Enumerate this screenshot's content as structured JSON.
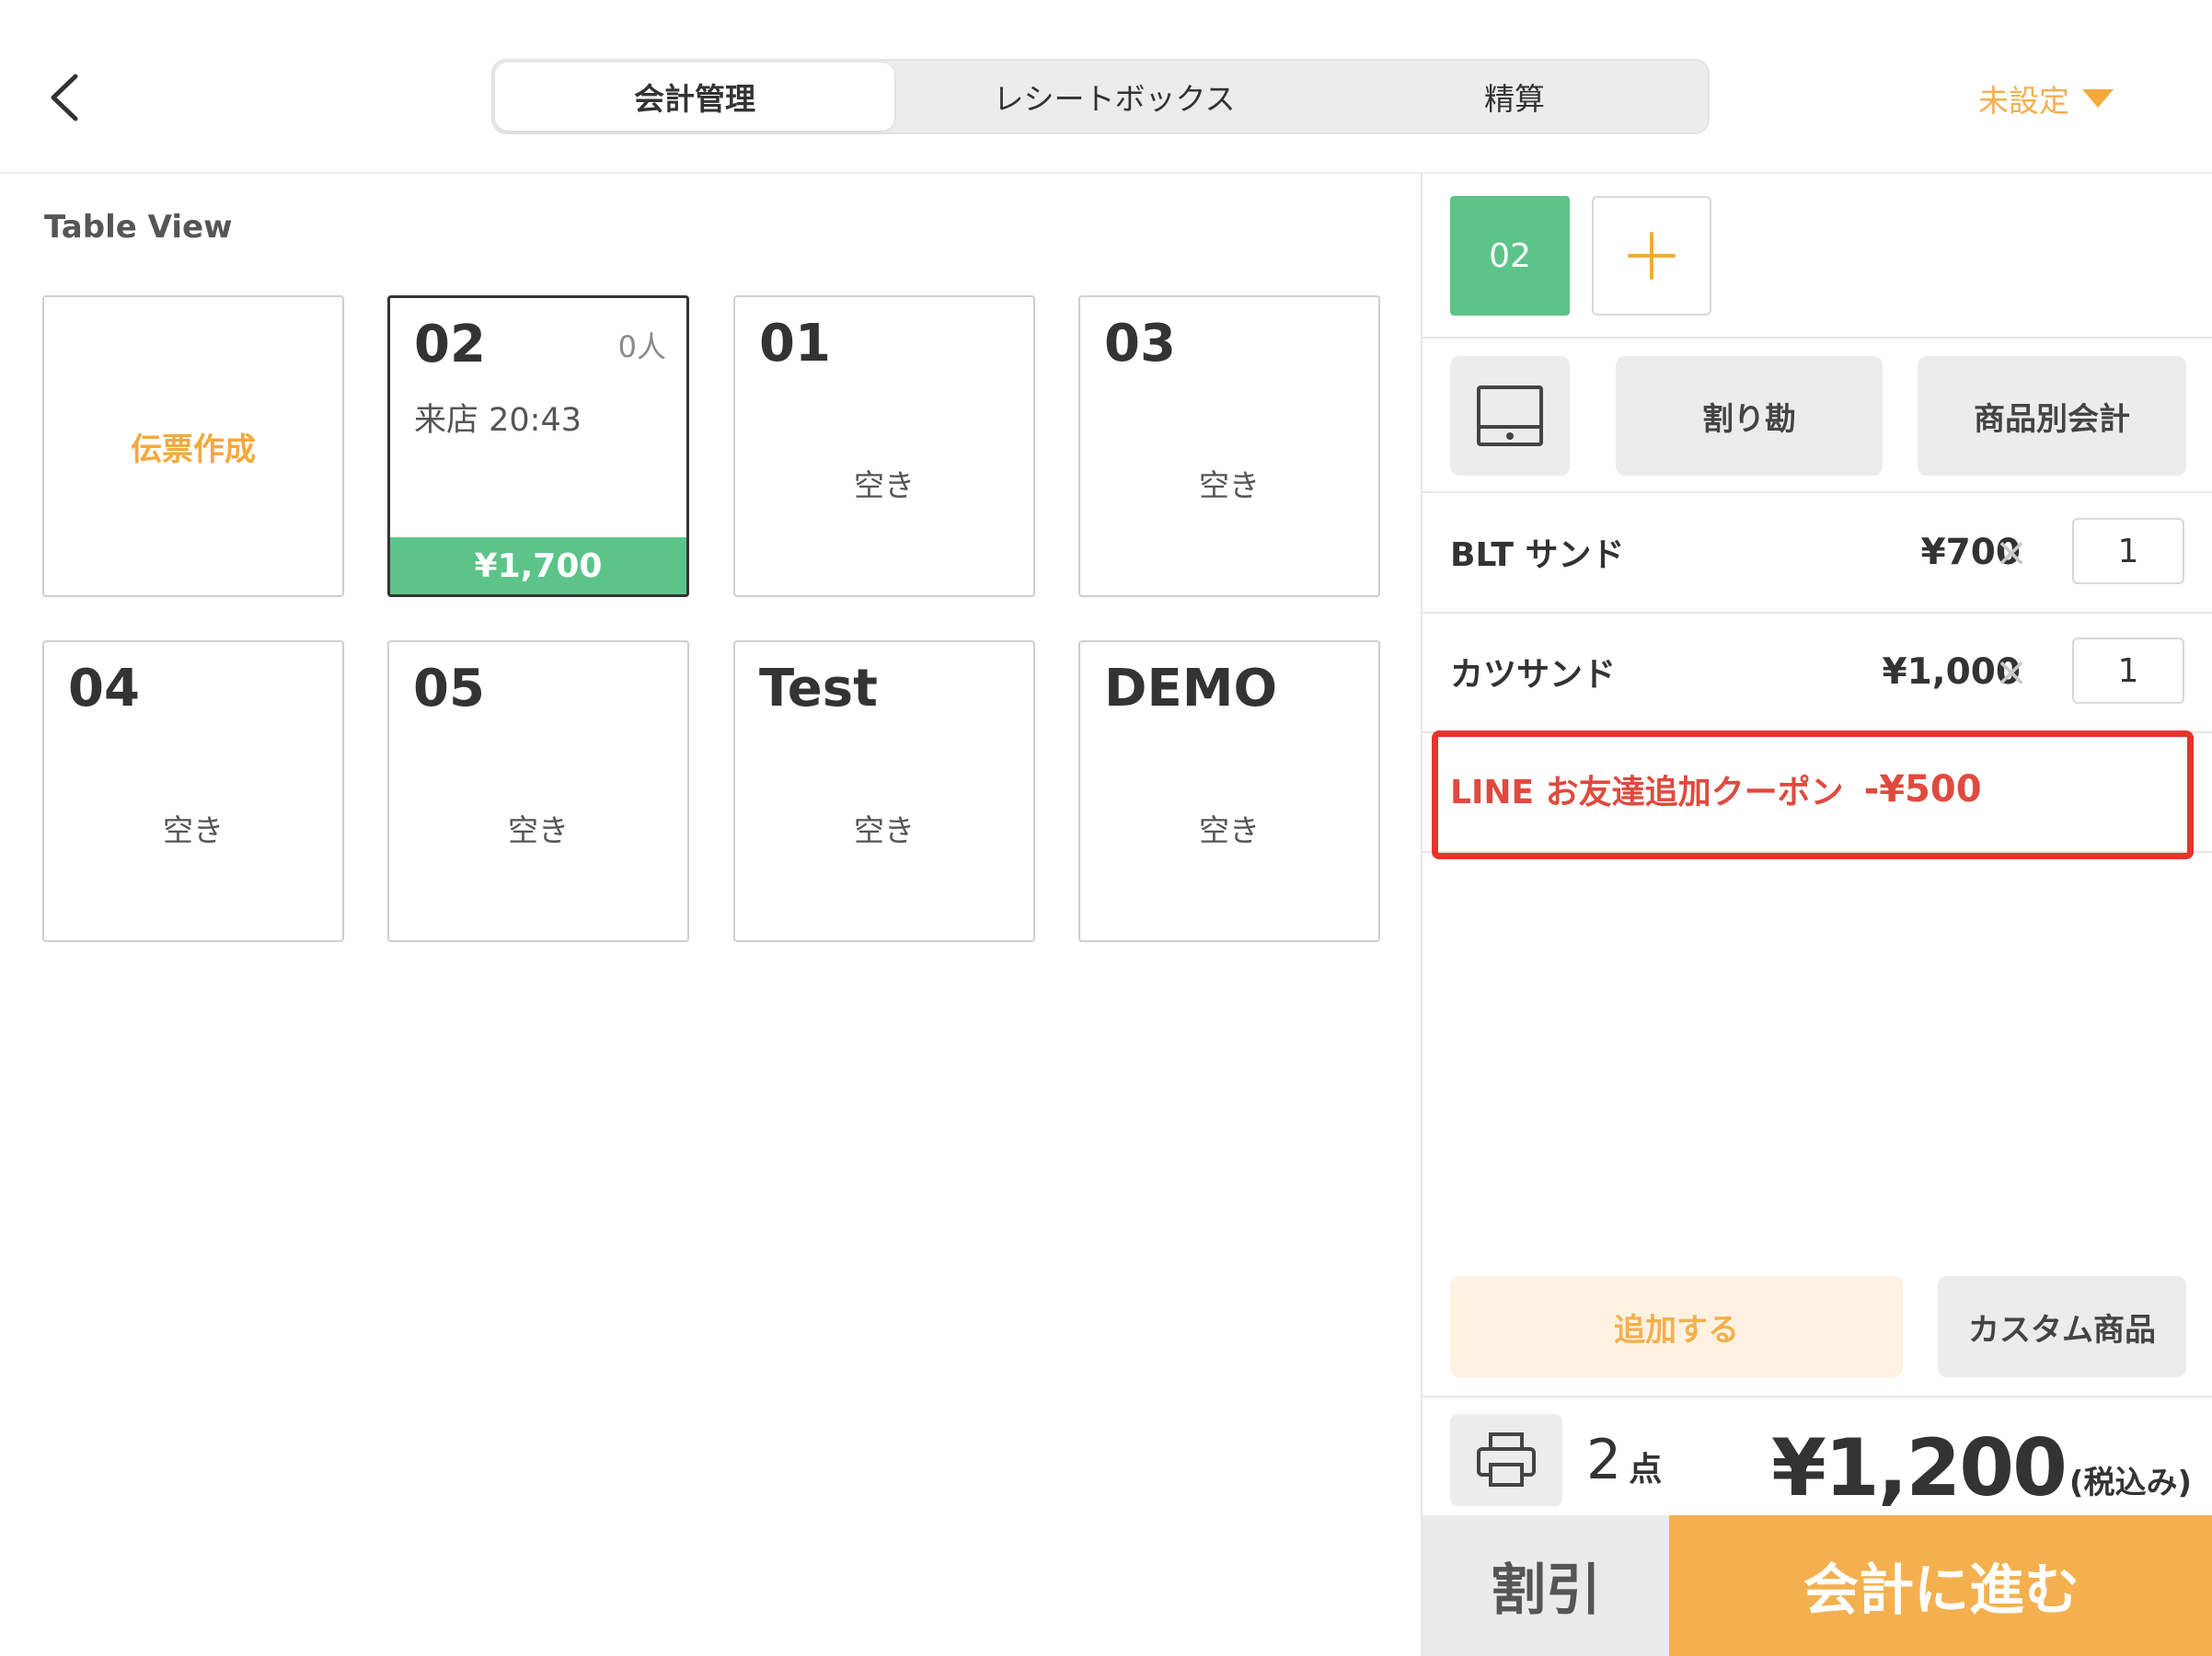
{
  "header": {
    "tabs": [
      {
        "label": "会計管理",
        "active": true
      },
      {
        "label": "レシートボックス",
        "active": false
      },
      {
        "label": "精算",
        "active": false
      }
    ],
    "staff_label": "未設定"
  },
  "table_view": {
    "title": "Table View",
    "create_slip_label": "伝票作成",
    "tables": [
      {
        "name": "02",
        "people": "0人",
        "visit": "来店 20:43",
        "amount": "¥1,700",
        "selected": true
      },
      {
        "name": "01",
        "status": "空き"
      },
      {
        "name": "03",
        "status": "空き"
      },
      {
        "name": "04",
        "status": "空き"
      },
      {
        "name": "05",
        "status": "空き"
      },
      {
        "name": "Test",
        "status": "空き"
      },
      {
        "name": "DEMO",
        "status": "空き"
      }
    ]
  },
  "order": {
    "slip_tab": "02",
    "split_label": "割り勘",
    "by_item_label": "商品別会計",
    "items": [
      {
        "name": "BLT サンド",
        "price": "¥700",
        "qty": "1"
      },
      {
        "name": "カツサンド",
        "price": "¥1,000",
        "qty": "1"
      }
    ],
    "coupon": {
      "name": "LINE お友達追加クーポン",
      "amount": "-¥500"
    },
    "add_label": "追加する",
    "custom_label": "カスタム商品",
    "count": "2",
    "count_unit": "点",
    "total": "¥1,200",
    "tax_note": "(税込み)",
    "discount_label": "割引",
    "checkout_label": "会計に進む"
  },
  "colors": {
    "accent_orange": "#f4b04f",
    "active_green": "#5cc489",
    "coupon_red": "#e04a3e",
    "highlight_red": "#e5342b"
  },
  "icons": [
    "chevron-left-icon",
    "caret-down-icon",
    "plus-icon",
    "cash-drawer-icon",
    "close-icon",
    "printer-icon"
  ]
}
